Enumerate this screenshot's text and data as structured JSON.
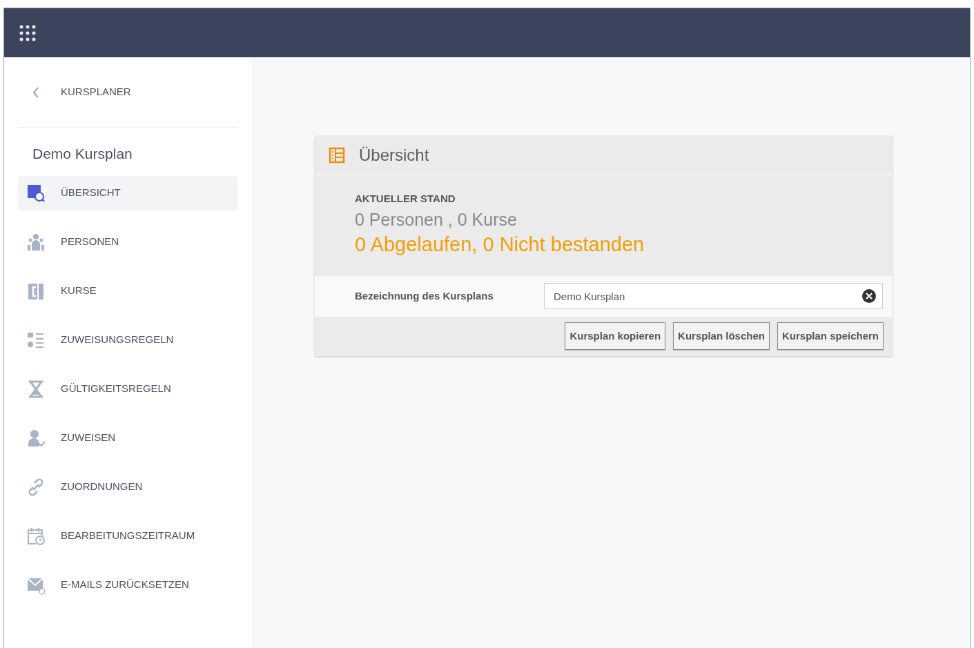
{
  "sidebar": {
    "back_label": "KURSPLANER",
    "title": "Demo Kursplan",
    "items": [
      {
        "label": "ÜBERSICHT",
        "selected": true
      },
      {
        "label": "PERSONEN",
        "selected": false
      },
      {
        "label": "KURSE",
        "selected": false
      },
      {
        "label": "ZUWEISUNGSREGELN",
        "selected": false
      },
      {
        "label": "GÜLTIGKEITSREGELN",
        "selected": false
      },
      {
        "label": "ZUWEISEN",
        "selected": false
      },
      {
        "label": "ZUORDNUNGEN",
        "selected": false
      },
      {
        "label": "BEARBEITUNGSZEITRAUM",
        "selected": false
      },
      {
        "label": "E-MAILS ZURÜCKSETZEN",
        "selected": false
      }
    ]
  },
  "card": {
    "title": "Übersicht",
    "section_label": "AKTUELLER STAND",
    "summary": "0 Personen , 0 Kurse",
    "warning": "0 Abgelaufen, 0 Nicht bestanden",
    "field": {
      "label": "Bezeichnung des Kursplans",
      "value": "Demo Kursplan"
    },
    "buttons": [
      "Kursplan kopieren",
      "Kursplan löschen",
      "Kursplan speichern"
    ]
  }
}
